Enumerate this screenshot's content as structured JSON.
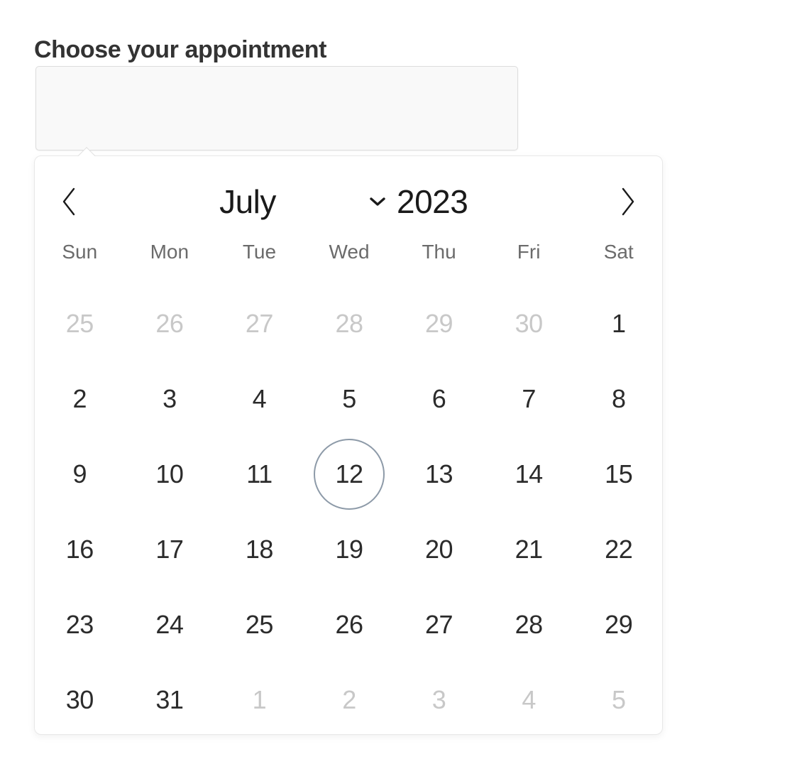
{
  "page": {
    "title": "Choose your appointment"
  },
  "date_field": {
    "value": "",
    "placeholder": ""
  },
  "calendar": {
    "prev_icon": "chevron-left-icon",
    "next_icon": "chevron-right-icon",
    "month": "July",
    "year": "2023",
    "year_dropdown_icon": "chevron-down-icon",
    "weekdays": [
      "Sun",
      "Mon",
      "Tue",
      "Wed",
      "Thu",
      "Fri",
      "Sat"
    ],
    "selected_day": 12,
    "accent_color": "#8d9aa8",
    "muted_color": "#c8c8c8",
    "weeks": [
      [
        {
          "day": "25",
          "outside": true
        },
        {
          "day": "26",
          "outside": true
        },
        {
          "day": "27",
          "outside": true
        },
        {
          "day": "28",
          "outside": true
        },
        {
          "day": "29",
          "outside": true
        },
        {
          "day": "30",
          "outside": true
        },
        {
          "day": "1",
          "outside": false
        }
      ],
      [
        {
          "day": "2",
          "outside": false
        },
        {
          "day": "3",
          "outside": false
        },
        {
          "day": "4",
          "outside": false
        },
        {
          "day": "5",
          "outside": false
        },
        {
          "day": "6",
          "outside": false
        },
        {
          "day": "7",
          "outside": false
        },
        {
          "day": "8",
          "outside": false
        }
      ],
      [
        {
          "day": "9",
          "outside": false
        },
        {
          "day": "10",
          "outside": false
        },
        {
          "day": "11",
          "outside": false
        },
        {
          "day": "12",
          "outside": false,
          "selected": true
        },
        {
          "day": "13",
          "outside": false
        },
        {
          "day": "14",
          "outside": false
        },
        {
          "day": "15",
          "outside": false
        }
      ],
      [
        {
          "day": "16",
          "outside": false
        },
        {
          "day": "17",
          "outside": false
        },
        {
          "day": "18",
          "outside": false
        },
        {
          "day": "19",
          "outside": false
        },
        {
          "day": "20",
          "outside": false
        },
        {
          "day": "21",
          "outside": false
        },
        {
          "day": "22",
          "outside": false
        }
      ],
      [
        {
          "day": "23",
          "outside": false
        },
        {
          "day": "24",
          "outside": false
        },
        {
          "day": "25",
          "outside": false
        },
        {
          "day": "26",
          "outside": false
        },
        {
          "day": "27",
          "outside": false
        },
        {
          "day": "28",
          "outside": false
        },
        {
          "day": "29",
          "outside": false
        }
      ],
      [
        {
          "day": "30",
          "outside": false
        },
        {
          "day": "31",
          "outside": false
        },
        {
          "day": "1",
          "outside": true
        },
        {
          "day": "2",
          "outside": true
        },
        {
          "day": "3",
          "outside": true
        },
        {
          "day": "4",
          "outside": true
        },
        {
          "day": "5",
          "outside": true
        }
      ]
    ]
  }
}
